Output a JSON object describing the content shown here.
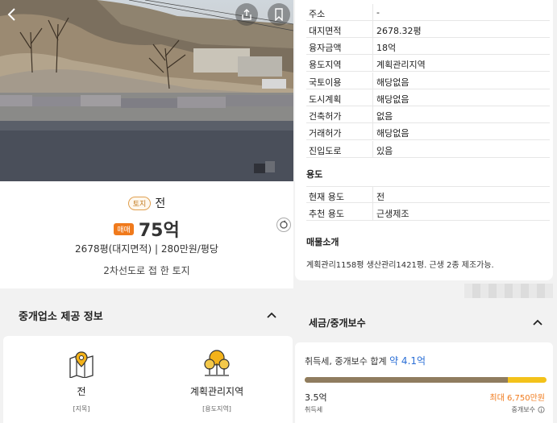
{
  "listing": {
    "category_badge": "토지",
    "category": "전",
    "deal_badge": "매매",
    "price": "75억",
    "detail": "2678평(대지면적) | 280만원/평당",
    "description": "2차선도로 접 한 토지"
  },
  "agent_section": {
    "title": "중개업소 제공 정보",
    "items": [
      {
        "icon": "map-pin-icon",
        "value": "전",
        "label": "[지목]"
      },
      {
        "icon": "trees-icon",
        "value": "계획관리지역",
        "label": "[용도지역]"
      }
    ]
  },
  "info_table": [
    {
      "key": "주소",
      "value": "-"
    },
    {
      "key": "대지면적",
      "value": "2678.32평"
    },
    {
      "key": "융자금액",
      "value": "18억"
    },
    {
      "key": "용도지역",
      "value": "계획관리지역"
    },
    {
      "key": "국토이용",
      "value": "해당없음"
    },
    {
      "key": "도시계획",
      "value": "해당없음"
    },
    {
      "key": "건축허가",
      "value": "없음"
    },
    {
      "key": "거래허가",
      "value": "해당없음"
    },
    {
      "key": "진입도로",
      "value": "있음"
    }
  ],
  "usage_section": {
    "title": "용도",
    "rows": [
      {
        "key": "현재 용도",
        "value": "전"
      },
      {
        "key": "추천 용도",
        "value": "근생제조"
      }
    ]
  },
  "intro_section": {
    "title": "매물소개",
    "text": "계획관리1158평 생산관리1421평. 근생 2종 제조가능."
  },
  "tax_section": {
    "title": "세금/중개보수",
    "sum_label": "취득세, 중개보수 합계",
    "sum_value": "약 4.1억",
    "acq_tax_value": "3.5억",
    "acq_tax_label": "취득세",
    "fee_value": "최대 6,750만원",
    "fee_label": "중개보수",
    "acq_fraction": 0.84,
    "colors": {
      "acq": "#8f7c5f",
      "fee": "#f3c21a",
      "sum": "#2b6fd6"
    }
  }
}
